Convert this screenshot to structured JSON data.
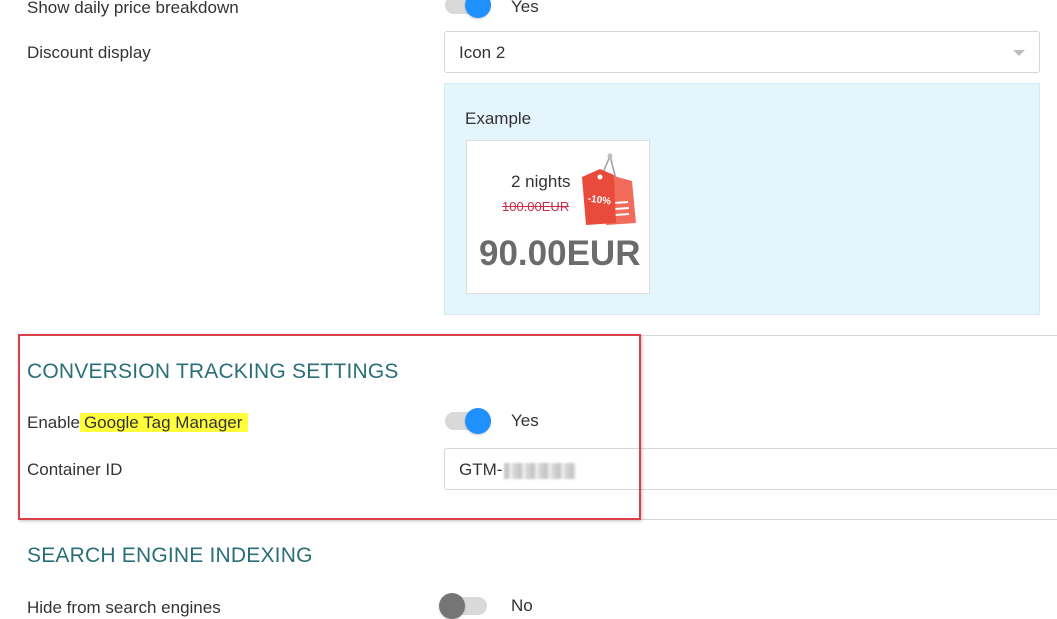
{
  "booking": {
    "daily_price_label": "Show daily price breakdown",
    "daily_price_state": "Yes",
    "discount_label": "Discount display",
    "discount_value": "Icon 2",
    "example": {
      "title": "Example",
      "nights": "2 nights",
      "old_price": "100.00EUR",
      "new_price": "90.00EUR",
      "badge": "-10%"
    }
  },
  "conversion": {
    "title": "CONVERSION TRACKING SETTINGS",
    "gtm_label_prefix": "Enable",
    "gtm_label_highlight": "Google Tag Manager",
    "gtm_state": "Yes",
    "container_label": "Container ID",
    "container_value": "GTM-"
  },
  "indexing": {
    "title": "SEARCH ENGINE INDEXING",
    "hide_label": "Hide from search engines",
    "hide_state": "No"
  },
  "colors": {
    "accent": "#1e90ff",
    "section_title": "#2a6f78",
    "highlight": "#ffff3b",
    "annotation_frame": "#d9404a",
    "example_bg": "#e4f5fc"
  }
}
